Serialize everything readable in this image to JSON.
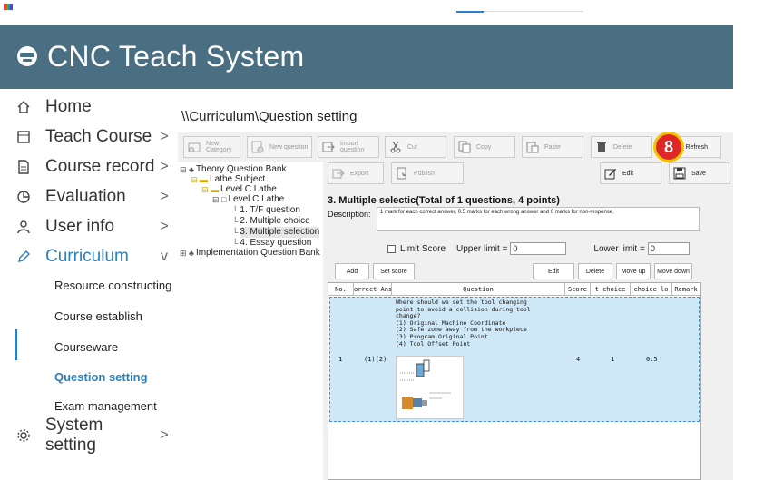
{
  "app": {
    "title": "CNC Teach System"
  },
  "sidebar": {
    "items": [
      {
        "label": "Home"
      },
      {
        "label": "Teach Course",
        "chevron": ">"
      },
      {
        "label": "Course record",
        "chevron": ">"
      },
      {
        "label": "Evaluation",
        "chevron": ">"
      },
      {
        "label": "User info",
        "chevron": ">"
      },
      {
        "label": "Curriculum",
        "chevron": "v"
      },
      {
        "label": "System setting",
        "chevron": ">"
      }
    ],
    "subitems": [
      {
        "label": "Resource constructing"
      },
      {
        "label": "Course establish"
      },
      {
        "label": "Courseware"
      },
      {
        "label": "Question setting"
      },
      {
        "label": "Exam management"
      }
    ]
  },
  "breadcrumb": "\\\\Curriculum\\Question setting",
  "toolbar1": {
    "new_category": "New Category",
    "new_question": "New question",
    "import_question": "Import question",
    "cut": "Cut",
    "copy": "Copy",
    "paste": "Paste",
    "delete": "Delete",
    "refresh": "Refresh"
  },
  "toolbar2": {
    "export": "Export",
    "publish": "Publish",
    "edit": "Edit",
    "save": "Save"
  },
  "tree": {
    "root1": "Theory Question Bank",
    "lathe_subject": "Lathe Subject",
    "level_c_lathe": "Level C Lathe",
    "level_c_lathe_child": "Level C Lathe",
    "q1": "1. T/F question",
    "q2": "2. Multiple choice",
    "q3": "3. Multiple selection",
    "q4": "4. Essay question",
    "root2": "Implementation Question Bank"
  },
  "section": {
    "title": "3. Multiple selectic(Total of 1 questions, 4 points)",
    "description_label": "Description:",
    "description": "1 mark for each correct answer, 0.5 marks for each wrong answer and 0 marks for non-response.",
    "limit_score": "Limit Score",
    "upper_limit": "Upper limit =",
    "upper_value": "0",
    "lower_limit": "Lower limit =",
    "lower_value": "0"
  },
  "actions": {
    "add": "Add",
    "set_score": "Set score",
    "edit": "Edit",
    "delete": "Delete",
    "move_up": "Move up",
    "move_down": "Move down"
  },
  "grid": {
    "headers": [
      "No.",
      "orrect Ans",
      "Question",
      "Score",
      "t choice",
      "choice lo",
      "Remark"
    ],
    "row": {
      "no": "1",
      "answer": "(1)(2)",
      "question_lines": [
        "Where should we set the tool changing",
        "point to avoid a collision during tool",
        "change?",
        "(1) Original Machine Coordinate",
        "(2) Safe zone away from the workpiece",
        "(3) Program Original Point",
        "(4) Tool Offset Point"
      ],
      "score": "4",
      "correct_choice": "1",
      "choice_loss": "0.5"
    }
  },
  "step_badge": "8",
  "colors": {
    "header": "#4a6f82",
    "accent": "#2c7fb8",
    "selected_row": "#cfe8f7",
    "badge": "#e02727"
  }
}
